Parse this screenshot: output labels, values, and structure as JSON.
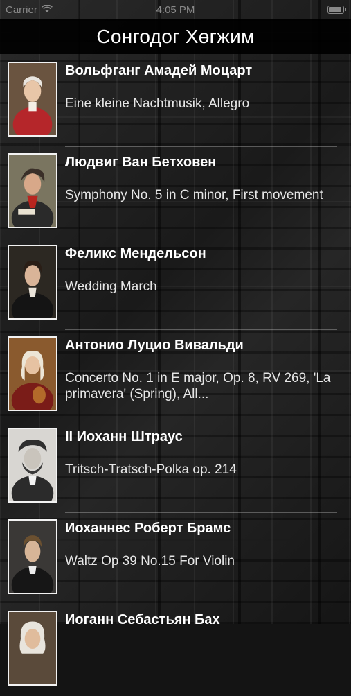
{
  "status_bar": {
    "carrier": "Carrier",
    "time": "4:05 PM",
    "icons": [
      "wifi-icon",
      "battery-icon"
    ]
  },
  "nav": {
    "title": "Сонгодог Хөгжим"
  },
  "colors": {
    "nav_bg": "#000000",
    "text": "#ffffff",
    "thumb_border": "#f2f2f2"
  },
  "composers": [
    {
      "name": "Вольфганг Амадей Моцарт",
      "piece": "Eine kleine Nachtmusik, Allegro"
    },
    {
      "name": "Людвиг Ван Бетховен",
      "piece": "Symphony No. 5 in C minor, First movement"
    },
    {
      "name": "Феликс Мендельсон",
      "piece": "Wedding March"
    },
    {
      "name": "Антонио Луцио Вивальди",
      "piece": "Concerto No. 1 in E major, Op. 8, RV 269, 'La primavera' (Spring), All..."
    },
    {
      "name": "II Иоханн Штраус",
      "piece": "Tritsch-Tratsch-Polka op. 214"
    },
    {
      "name": "Иоханнес Роберт Брамс",
      "piece": "Waltz Op 39 No.15 For Violin"
    },
    {
      "name": "Иоганн Себастьян Бах",
      "piece": ""
    }
  ]
}
